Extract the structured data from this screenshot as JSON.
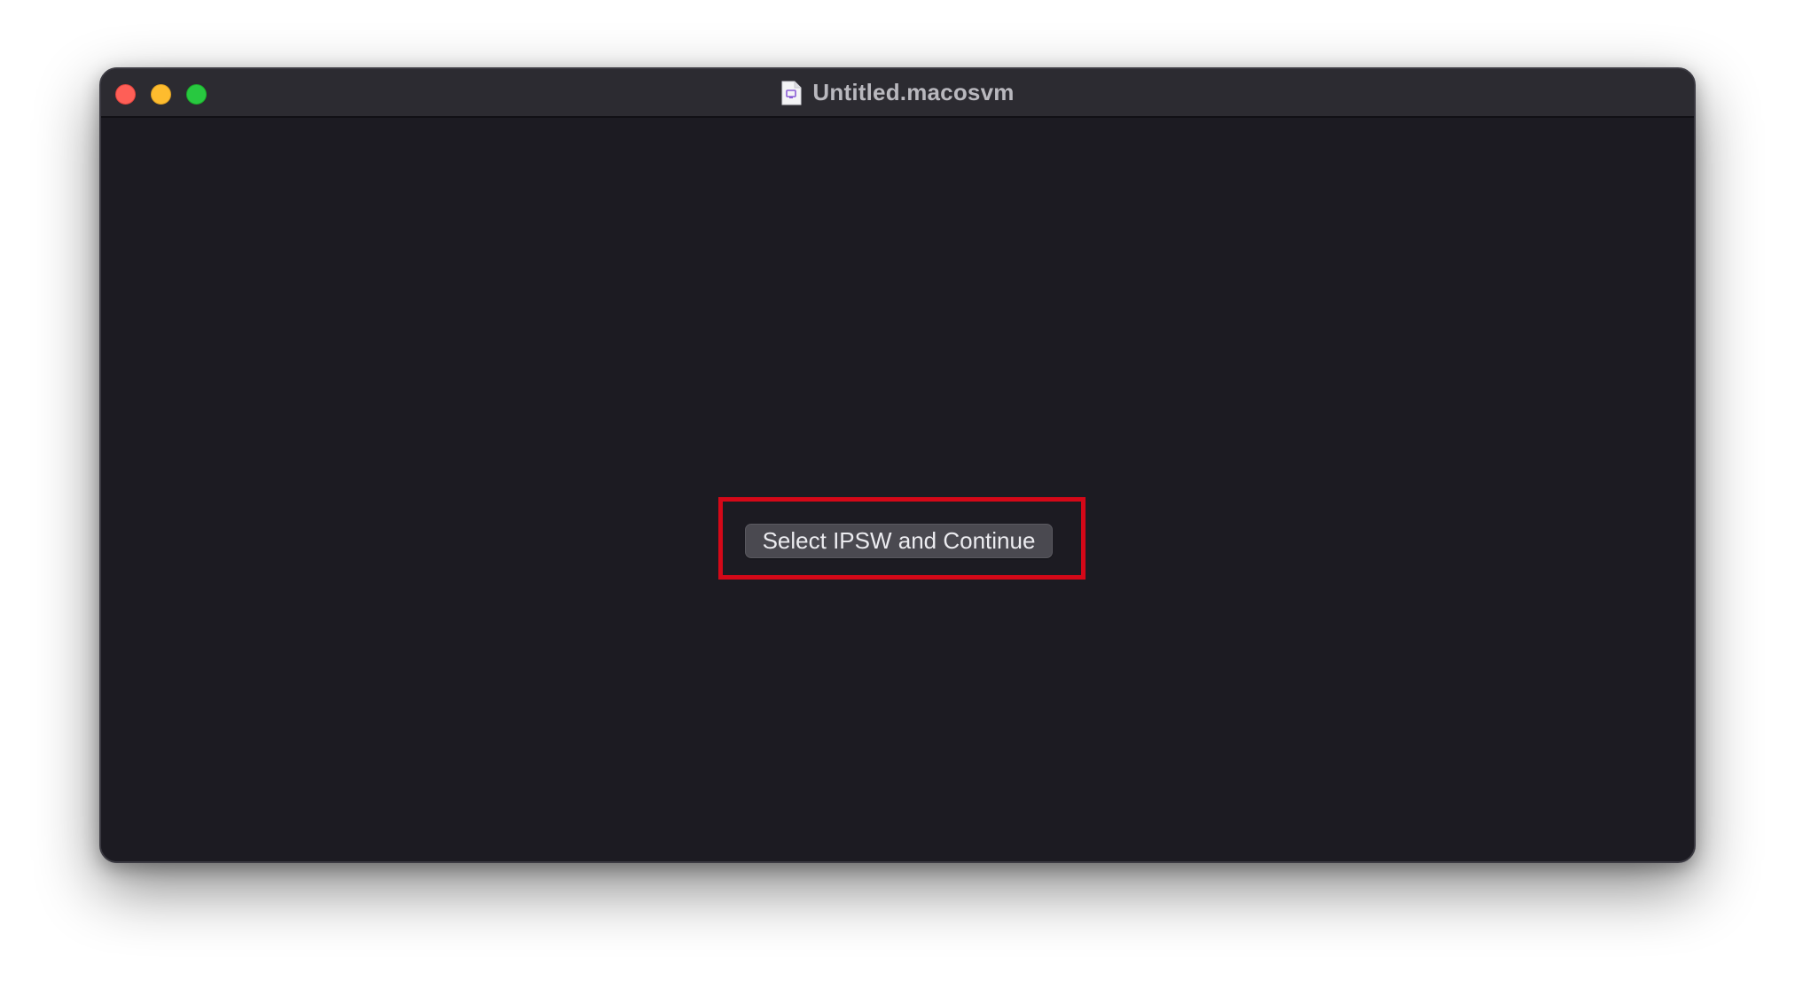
{
  "window": {
    "title": "Untitled.macosvm",
    "title_icon": "document-icon",
    "controls": [
      "close",
      "minimize",
      "zoom"
    ]
  },
  "main": {
    "primary_button_label": "Select IPSW and Continue",
    "highlight_color": "#d40818"
  },
  "colors": {
    "window_background": "#1c1b22",
    "titlebar": "#2c2b31",
    "close": "#fe5f57",
    "minimize": "#febc2e",
    "zoom": "#28c840",
    "button": "#4a4950"
  }
}
